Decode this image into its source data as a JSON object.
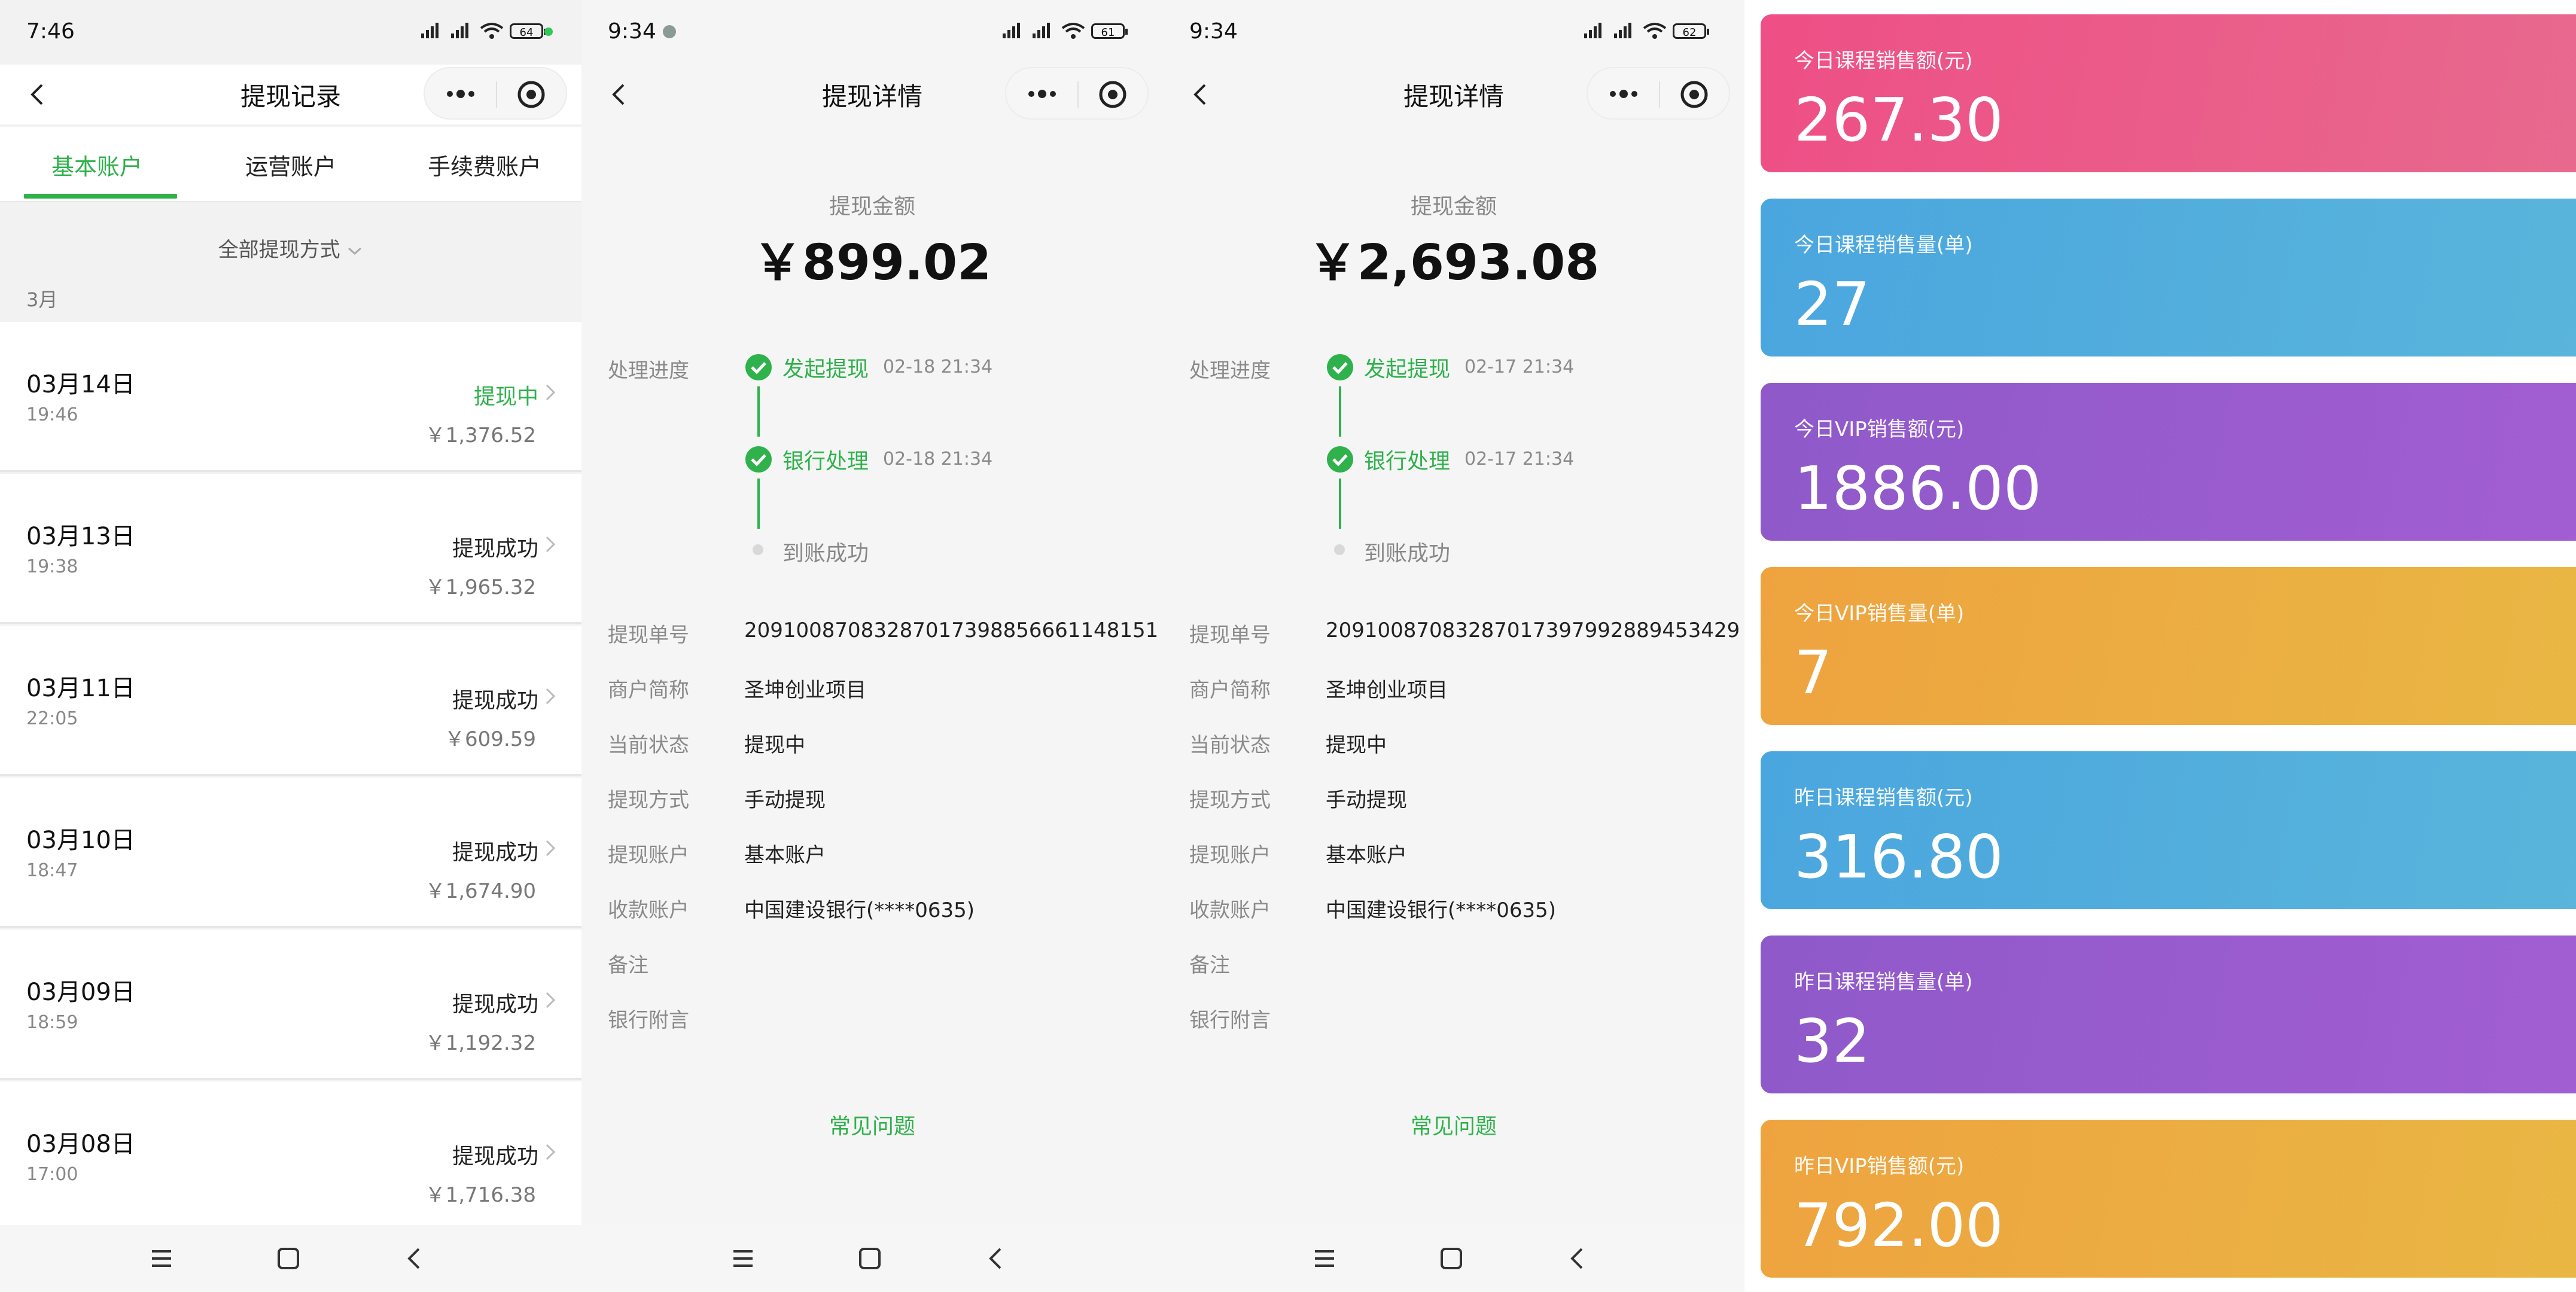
{
  "phones": [
    {
      "time": "7:46",
      "battery": "64",
      "title": "提现记录"
    },
    {
      "time": "9:34",
      "battery": "61",
      "title": "提现详情"
    },
    {
      "time": "9:34",
      "battery": "62",
      "title": "提现详情"
    }
  ],
  "records_page": {
    "tabs": [
      "基本账户",
      "运营账户",
      "手续费账户"
    ],
    "filter": "全部提现方式",
    "month": "3月",
    "records": [
      {
        "date": "03月14日",
        "time": "19:46",
        "status": "提现中",
        "amount": "￥1,376.52"
      },
      {
        "date": "03月13日",
        "time": "19:38",
        "status": "提现成功",
        "amount": "￥1,965.32"
      },
      {
        "date": "03月11日",
        "time": "22:05",
        "status": "提现成功",
        "amount": "￥609.59"
      },
      {
        "date": "03月10日",
        "time": "18:47",
        "status": "提现成功",
        "amount": "￥1,674.90"
      },
      {
        "date": "03月09日",
        "time": "18:59",
        "status": "提现成功",
        "amount": "￥1,192.32"
      },
      {
        "date": "03月08日",
        "time": "17:00",
        "status": "提现成功",
        "amount": "￥1,716.38"
      }
    ]
  },
  "details": [
    {
      "amount_label": "提现金额",
      "amount": "￥899.02",
      "progress_label": "处理进度",
      "steps": [
        {
          "name": "发起提现",
          "time": "02-18 21:34"
        },
        {
          "name": "银行处理",
          "time": "02-18 21:34"
        },
        {
          "name": "到账成功",
          "time": ""
        }
      ],
      "fields": [
        {
          "label": "提现单号",
          "value": "20910087083287017398856661148151"
        },
        {
          "label": "商户简称",
          "value": "圣坤创业项目"
        },
        {
          "label": "当前状态",
          "value": "提现中"
        },
        {
          "label": "提现方式",
          "value": "手动提现"
        },
        {
          "label": "提现账户",
          "value": "基本账户"
        },
        {
          "label": "收款账户",
          "value": "中国建设银行(****0635)"
        },
        {
          "label": "备注",
          "value": ""
        },
        {
          "label": "银行附言",
          "value": ""
        }
      ],
      "faq": "常见问题"
    },
    {
      "amount_label": "提现金额",
      "amount": "￥2,693.08",
      "progress_label": "处理进度",
      "steps": [
        {
          "name": "发起提现",
          "time": "02-17 21:34"
        },
        {
          "name": "银行处理",
          "time": "02-17 21:34"
        },
        {
          "name": "到账成功",
          "time": ""
        }
      ],
      "fields": [
        {
          "label": "提现单号",
          "value": "20910087083287017397992889453429"
        },
        {
          "label": "商户简称",
          "value": "圣坤创业项目"
        },
        {
          "label": "当前状态",
          "value": "提现中"
        },
        {
          "label": "提现方式",
          "value": "手动提现"
        },
        {
          "label": "提现账户",
          "value": "基本账户"
        },
        {
          "label": "收款账户",
          "value": "中国建设银行(****0635)"
        },
        {
          "label": "备注",
          "value": ""
        },
        {
          "label": "银行附言",
          "value": ""
        }
      ],
      "faq": "常见问题"
    }
  ],
  "stat_cards": [
    {
      "label": "今日课程销售额(元)",
      "value": "267.30",
      "color_from": "#ee4f86",
      "color_to": "#e76a8e"
    },
    {
      "label": "今日课程销售量(单)",
      "value": "27",
      "color_from": "#4aa6de",
      "color_to": "#5ab5db"
    },
    {
      "label": "今日VIP销售额(元)",
      "value": "1886.00",
      "color_from": "#8f59c9",
      "color_to": "#a25ed3"
    },
    {
      "label": "今日VIP销售量(单)",
      "value": "7",
      "color_from": "#eea33f",
      "color_to": "#e9b744"
    },
    {
      "label": "昨日课程销售额(元)",
      "value": "316.80",
      "color_from": "#4aa6de",
      "color_to": "#5ab5db"
    },
    {
      "label": "昨日课程销售量(单)",
      "value": "32",
      "color_from": "#8f59c9",
      "color_to": "#a25ed3"
    },
    {
      "label": "昨日VIP销售额(元)",
      "value": "792.00",
      "color_from": "#eea33f",
      "color_to": "#e9b744"
    }
  ],
  "colors": {
    "accent": "#2fb14c"
  }
}
